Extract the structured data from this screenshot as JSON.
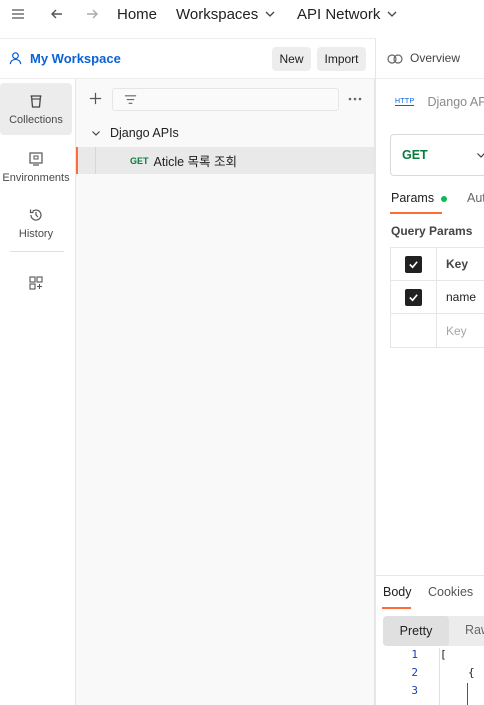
{
  "topbar": {
    "menu_icon": "hamburger-icon",
    "back_icon": "arrow-left-icon",
    "forward_icon": "arrow-right-icon",
    "home": "Home",
    "workspaces": "Workspaces",
    "api_network": "API Network"
  },
  "workspace": {
    "name": "My Workspace",
    "new_label": "New",
    "import_label": "Import"
  },
  "nav": [
    {
      "label": "Collections",
      "icon": "trash-bin-icon",
      "active": true
    },
    {
      "label": "Environments",
      "icon": "environment-icon",
      "active": false
    },
    {
      "label": "History",
      "icon": "history-icon",
      "active": false
    }
  ],
  "collections": {
    "name": "Django APIs",
    "request": {
      "method": "GET",
      "name": "Aticle 목록 조회"
    }
  },
  "editor": {
    "overview_tab": "Overview",
    "http_badge": "HTTP",
    "request_title": "Django API",
    "method": "GET",
    "tabs": [
      "Params",
      "Auth"
    ],
    "query_params_title": "Query Params",
    "params_header": "Key",
    "params_rows": [
      {
        "key": "name",
        "checked": true
      }
    ],
    "new_key_placeholder": "Key"
  },
  "response": {
    "tabs": [
      "Body",
      "Cookies"
    ],
    "formats": [
      "Pretty",
      "Raw"
    ],
    "line_numbers": [
      "1",
      "2",
      "3"
    ],
    "line1": "[",
    "line2": "{"
  },
  "colors": {
    "accent_blue": "#0b62d6",
    "accent_orange": "#ff6c37",
    "get_green": "#0b7a3e",
    "status_green": "#0cbb52"
  }
}
